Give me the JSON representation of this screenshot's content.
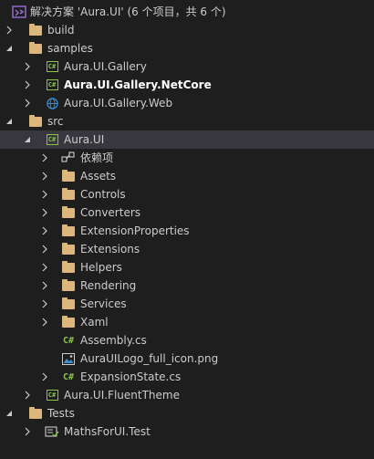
{
  "solution": {
    "label": "解决方案 'Aura.UI' (6 个项目，共 6 个)"
  },
  "tree": {
    "build": "build",
    "samples": "samples",
    "gallery": "Aura.UI.Gallery",
    "gallery_netcore": "Aura.UI.Gallery.NetCore",
    "gallery_web": "Aura.UI.Gallery.Web",
    "src": "src",
    "aura_ui": "Aura.UI",
    "dependencies": "依赖项",
    "assets": "Assets",
    "controls": "Controls",
    "converters": "Converters",
    "extension_properties": "ExtensionProperties",
    "extensions": "Extensions",
    "helpers": "Helpers",
    "rendering": "Rendering",
    "services": "Services",
    "xaml": "Xaml",
    "assembly_cs": "Assembly.cs",
    "logo_png": "AuraUILogo_full_icon.png",
    "expansion_state_cs": "ExpansionState.cs",
    "fluent_theme": "Aura.UI.FluentTheme",
    "tests": "Tests",
    "maths_test": "MathsForUI.Test"
  },
  "colors": {
    "folder": "#dcb67a",
    "csharp": "#8bc34a",
    "selection": "#37373d",
    "background": "#1e1e1e"
  }
}
